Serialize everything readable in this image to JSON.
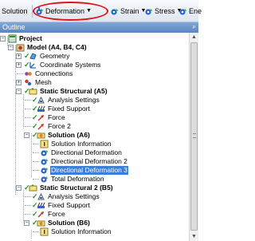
{
  "toolbar": {
    "items": [
      {
        "label": "Solution",
        "has_icon": false,
        "has_caret": false
      },
      {
        "label": "Deformation",
        "has_icon": true,
        "has_caret": true
      },
      {
        "label": "Strain",
        "has_icon": true,
        "has_caret": true
      },
      {
        "label": "Stress",
        "has_icon": true,
        "has_caret": true
      },
      {
        "label": "Ene",
        "has_icon": true,
        "has_caret": false
      }
    ],
    "highlight_color": "#e0141c"
  },
  "outline": {
    "title": "Outline",
    "pin_icon": "pin-icon"
  },
  "tree": [
    {
      "label": "Project",
      "icon": "project-icon",
      "bold": true
    },
    {
      "label": "Model (A4, B4, C4)",
      "icon": "model-icon",
      "bold": true
    },
    {
      "label": "Geometry",
      "icon": "geometry-icon",
      "bold": false
    },
    {
      "label": "Coordinate Systems",
      "icon": "coordinate-systems-icon",
      "bold": false
    },
    {
      "label": "Connections",
      "icon": "connections-icon",
      "bold": false
    },
    {
      "label": "Mesh",
      "icon": "mesh-icon",
      "bold": false
    },
    {
      "label": "Static Structural (A5)",
      "icon": "static-structural-icon",
      "bold": true
    },
    {
      "label": "Analysis Settings",
      "icon": "analysis-settings-icon",
      "bold": false
    },
    {
      "label": "Fixed Support",
      "icon": "fixed-support-icon",
      "bold": false
    },
    {
      "label": "Force",
      "icon": "force-icon",
      "bold": false
    },
    {
      "label": "Force 2",
      "icon": "force-icon",
      "bold": false
    },
    {
      "label": "Solution (A6)",
      "icon": "solution-icon",
      "bold": true
    },
    {
      "label": "Solution Information",
      "icon": "solution-information-icon",
      "bold": false
    },
    {
      "label": "Directional Deformation",
      "icon": "deformation-result-icon",
      "bold": false
    },
    {
      "label": "Directional Deformation 2",
      "icon": "deformation-result-icon",
      "bold": false
    },
    {
      "label": "Directional Deformation 3",
      "icon": "deformation-result-icon",
      "bold": false,
      "selected": true
    },
    {
      "label": "Total Deformation",
      "icon": "deformation-result-icon",
      "bold": false
    },
    {
      "label": "Static Structural 2 (B5)",
      "icon": "static-structural-icon",
      "bold": true
    },
    {
      "label": "Analysis Settings",
      "icon": "analysis-settings-icon",
      "bold": false
    },
    {
      "label": "Fixed Support",
      "icon": "fixed-support-icon",
      "bold": false
    },
    {
      "label": "Force",
      "icon": "force-icon",
      "bold": false
    },
    {
      "label": "Solution (B6)",
      "icon": "solution-icon",
      "bold": true
    },
    {
      "label": "Solution Information",
      "icon": "solution-information-icon",
      "bold": false
    }
  ],
  "colors": {
    "selection": "#3d7fd6",
    "header": "#6b93cb",
    "check": "#1a9a1a"
  }
}
